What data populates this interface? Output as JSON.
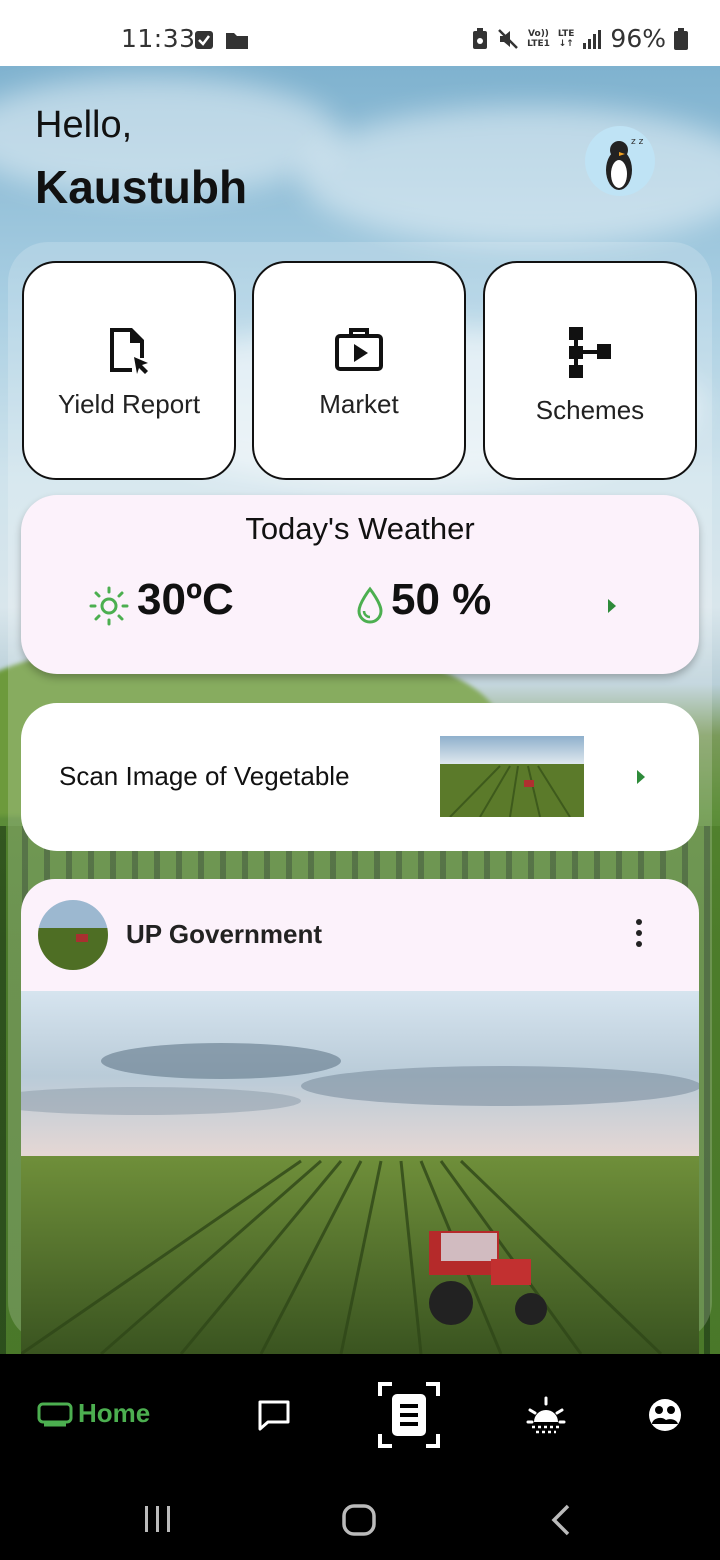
{
  "status_bar": {
    "time": "11:33",
    "volte_top": "Vo))",
    "volte_bottom": "LTE1",
    "lte": "LTE",
    "battery": "96%"
  },
  "header": {
    "greeting": "Hello,",
    "name": "Kaustubh"
  },
  "tiles": [
    {
      "label": "Yield Report",
      "icon": "file-cursor-icon"
    },
    {
      "label": "Market",
      "icon": "briefcase-play-icon"
    },
    {
      "label": "Schemes",
      "icon": "hierarchy-icon"
    }
  ],
  "weather": {
    "title": "Today's Weather",
    "temperature": "30ºC",
    "humidity": "50 %"
  },
  "scan": {
    "label": "Scan Image of Vegetable"
  },
  "post": {
    "author": "UP Government"
  },
  "bottom_nav": {
    "home_label": "Home",
    "active_color": "#4caf50"
  }
}
